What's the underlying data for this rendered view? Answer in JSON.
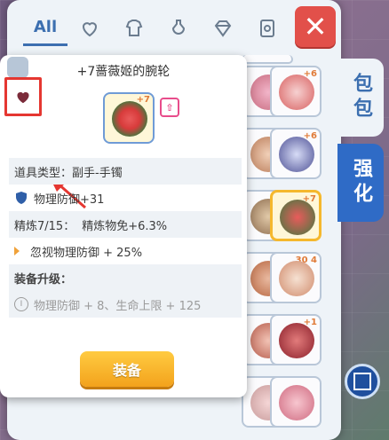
{
  "bag": {
    "tabs": [
      {
        "label": "All",
        "icon": "all-tab"
      },
      {
        "label": "",
        "icon": "heart-tab-icon"
      },
      {
        "label": "",
        "icon": "armor-tab-icon"
      },
      {
        "label": "",
        "icon": "potion-tab-icon"
      },
      {
        "label": "",
        "icon": "gem-tab-icon"
      },
      {
        "label": "",
        "icon": "card-tab-icon"
      }
    ],
    "close_label": "✕",
    "side_tabs": {
      "bag": "包包",
      "enhance": "强化"
    },
    "slot_levels": [
      "+6",
      "+6",
      "+7",
      "30 4",
      "+1"
    ]
  },
  "tooltip": {
    "title": "+7蔷薇姬的腕轮",
    "item_level": "+7",
    "up_badge": "⇧",
    "type_label": "道具类型：副手-手镯",
    "defense": "物理防御+31",
    "refine": "精炼7/15：",
    "refine_bonus": "精炼物免+6.3%",
    "ignore_def": "忽视物理防御 + 25%",
    "upgrade_header": "装备升级：",
    "upgrade_line": "物理防御 + 8、生命上限 + 125",
    "upgrade_numeral": "I",
    "equip_label": "装备"
  },
  "colors": {
    "accent": "#3c6fb0",
    "close": "#e2504a",
    "highlight": "#e53731",
    "equip": "#f3a21c"
  }
}
